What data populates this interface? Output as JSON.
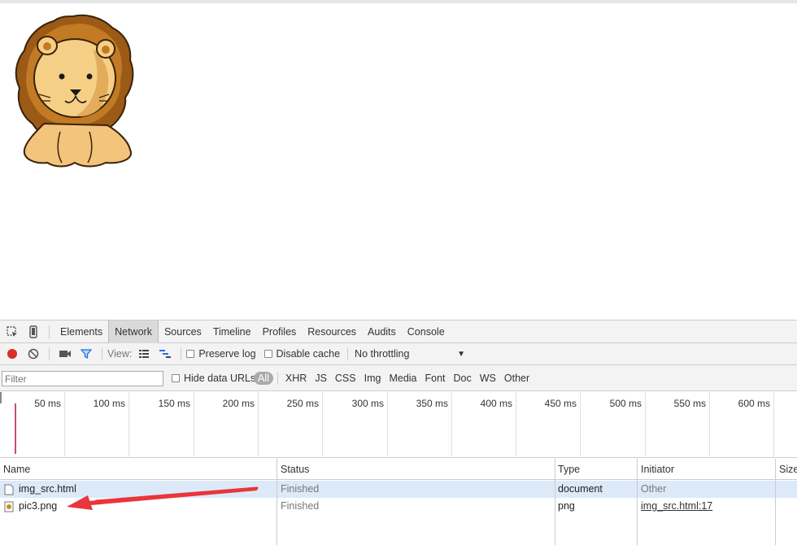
{
  "devtools": {
    "tabs": [
      "Elements",
      "Network",
      "Sources",
      "Timeline",
      "Profiles",
      "Resources",
      "Audits",
      "Console"
    ],
    "active_tab": "Network",
    "toolbar": {
      "view_label": "View:",
      "preserve_log": "Preserve log",
      "disable_cache": "Disable cache",
      "throttling": "No throttling"
    },
    "filter": {
      "placeholder": "Filter",
      "hide_data_urls": "Hide data URLs",
      "types": [
        "All",
        "XHR",
        "JS",
        "CSS",
        "Img",
        "Media",
        "Font",
        "Doc",
        "WS",
        "Other"
      ]
    },
    "timeline_ticks": [
      "50 ms",
      "100 ms",
      "150 ms",
      "200 ms",
      "250 ms",
      "300 ms",
      "350 ms",
      "400 ms",
      "450 ms",
      "500 ms",
      "550 ms",
      "600 ms"
    ],
    "columns": [
      "Name",
      "Status",
      "Type",
      "Initiator",
      "Size"
    ],
    "rows": [
      {
        "name": "img_src.html",
        "status": "Finished",
        "type": "document",
        "initiator": "Other"
      },
      {
        "name": "pic3.png",
        "status": "Finished",
        "type": "png",
        "initiator": "img_src.html:17"
      }
    ]
  },
  "colors": {
    "record": "#d93025",
    "selected_row": "#dce9f8",
    "annotation_arrow": "#e8363b",
    "filter_icon": "#1a73e8"
  }
}
